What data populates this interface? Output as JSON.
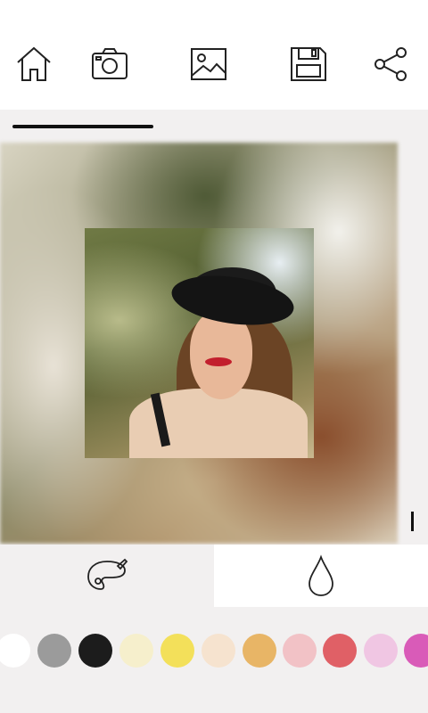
{
  "toolbar": {
    "buttons": [
      {
        "icon": "home-icon"
      },
      {
        "icon": "camera-icon"
      },
      {
        "icon": "gallery-icon"
      },
      {
        "icon": "save-icon"
      },
      {
        "icon": "share-icon"
      }
    ]
  },
  "editor": {
    "background_mode": "blur"
  },
  "tabs": [
    {
      "icon": "palette-icon",
      "selected": false
    },
    {
      "icon": "drop-icon",
      "selected": true
    }
  ],
  "colors": {
    "swatches": [
      "#ffffff",
      "#9b9b9b",
      "#1c1c1c",
      "#f6efcc",
      "#f3e05a",
      "#f6e3cf",
      "#e8b566",
      "#f2c2c6",
      "#e06066",
      "#f0c6e3",
      "#d95bb8"
    ]
  }
}
